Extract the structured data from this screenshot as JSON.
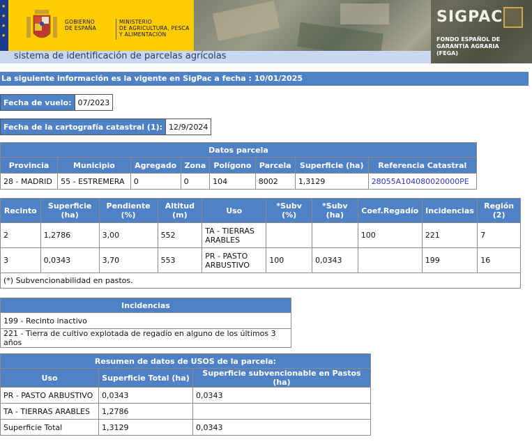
{
  "header": {
    "gobierno": "GOBIERNO\nDE ESPAÑA",
    "ministerio": "MINISTERIO\nDE AGRICULTURA, PESCA\nY ALIMENTACIÓN",
    "logo": "SIGPAC",
    "fega": "FONDO ESPAÑOL DE\nGARANTÍA AGRARIA\n(FEGA)",
    "subtitle": "sistema de identificación de parcelas agrícolas",
    "colors": {
      "yellow": "#ffcc00",
      "eu_blue": "#1a3a8c",
      "bar": "#4f81c7"
    }
  },
  "info": "La siguiente información es la vigente en SigPac a fecha : 10/01/2025",
  "vuelo": {
    "label": "Fecha de vuelo:",
    "value": "07/2023"
  },
  "cartografia": {
    "label": "Fecha de la cartografía catastral (1):",
    "value": "12/9/2024"
  },
  "parcela": {
    "caption": "Datos parcela",
    "headers": [
      "Provincia",
      "Municipio",
      "Agregado",
      "Zona",
      "Polígono",
      "Parcela",
      "Superficie (ha)",
      "Referencia Catastral"
    ],
    "row": [
      "28 - MADRID",
      "55 - ESTREMERA",
      "0",
      "0",
      "104",
      "8002",
      "1,3129",
      "28055A104080020000PE"
    ]
  },
  "recintos": {
    "headers": [
      "Recinto",
      "Superficie (ha)",
      "Pendiente (%)",
      "Altitud (m)",
      "Uso",
      "*Subv (%)",
      "*Subv (ha)",
      "Coef.Regadío",
      "Incidencias",
      "Región (2)"
    ],
    "rows": [
      [
        "2",
        "1,2786",
        "3,00",
        "552",
        "TA - TIERRAS ARABLES",
        "",
        "",
        "100",
        "221",
        "7"
      ],
      [
        "3",
        "0,0343",
        "3,70",
        "553",
        "PR - PASTO ARBUSTIVO",
        "100",
        "0,0343",
        "",
        "199",
        "16"
      ]
    ],
    "footnote": "(*) Subvencionabilidad en pastos."
  },
  "incidencias": {
    "caption": "Incidencias",
    "items": [
      "199 - Recinto inactivo",
      "221 - Tierra de cultivo explotada de regadío en alguno de los últimos 3 años"
    ]
  },
  "usos": {
    "caption": "Resumen de datos de USOS de la parcela:",
    "headers": [
      "Uso",
      "Superficie Total (ha)",
      "Superficie subvencionable en Pastos (ha)"
    ],
    "rows": [
      [
        "PR - PASTO ARBUSTIVO",
        "0,0343",
        "0,0343"
      ],
      [
        "TA - TIERRAS ARABLES",
        "1,2786",
        ""
      ],
      [
        "Superficie Total",
        "1,3129",
        "0,0343"
      ]
    ]
  }
}
